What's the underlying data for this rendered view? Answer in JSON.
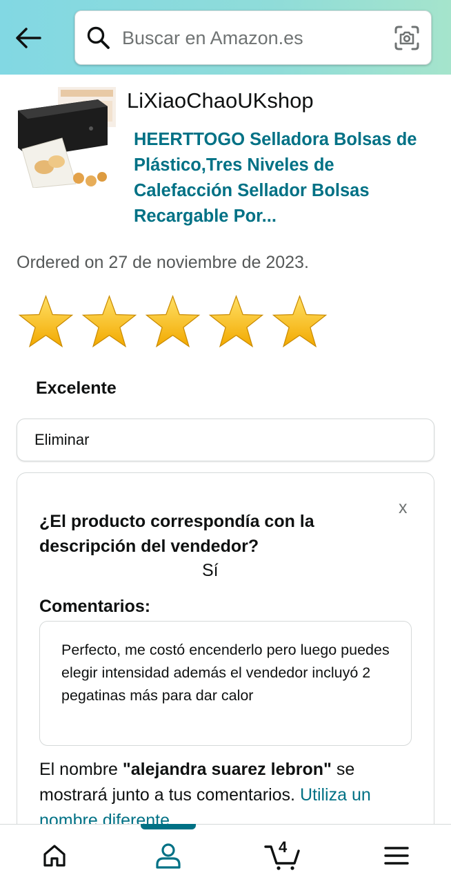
{
  "header": {
    "back_icon": "arrow-left-icon",
    "search": {
      "placeholder": "Buscar en Amazon.es",
      "icon": "search-icon",
      "lens_icon": "camera-lens-icon"
    },
    "colors": {
      "gradient_start": "#82d8e3",
      "gradient_end": "#a5e4cc"
    }
  },
  "product": {
    "seller": "LiXiaoChaoUKshop",
    "title": "HEERTTOGO Selladora Bolsas de Plástico,Tres Niveles de Calefacción Sellador Bolsas Recargable Por..."
  },
  "order": {
    "ordered_text": "Ordered on 27 de noviembre de 2023."
  },
  "rating": {
    "stars": 5,
    "max_stars": 5,
    "label": "Excelente",
    "star_color": "#f5b400"
  },
  "actions": {
    "delete_label": "Eliminar"
  },
  "feedback_card": {
    "close_label": "x",
    "question": "¿El producto correspondía con la descripción del vendedor?",
    "answer": "Sí",
    "comments_label": "Comentarios:",
    "comment_text": "Perfecto, me costó encenderlo pero luego puedes elegir intensidad además el vendedor incluyó 2 pegatinas más para dar calor",
    "name_prefix": "El nombre ",
    "name_value": "\"alejandra suarez lebron\"",
    "name_suffix": " se mostrará junto a tus comentarios. ",
    "name_link": "Utiliza un nombre diferente"
  },
  "bottom_nav": {
    "items": [
      "home-icon",
      "account-icon",
      "cart-icon",
      "menu-icon"
    ],
    "active": "account-icon",
    "cart_count": "4",
    "accent": "#007185"
  }
}
